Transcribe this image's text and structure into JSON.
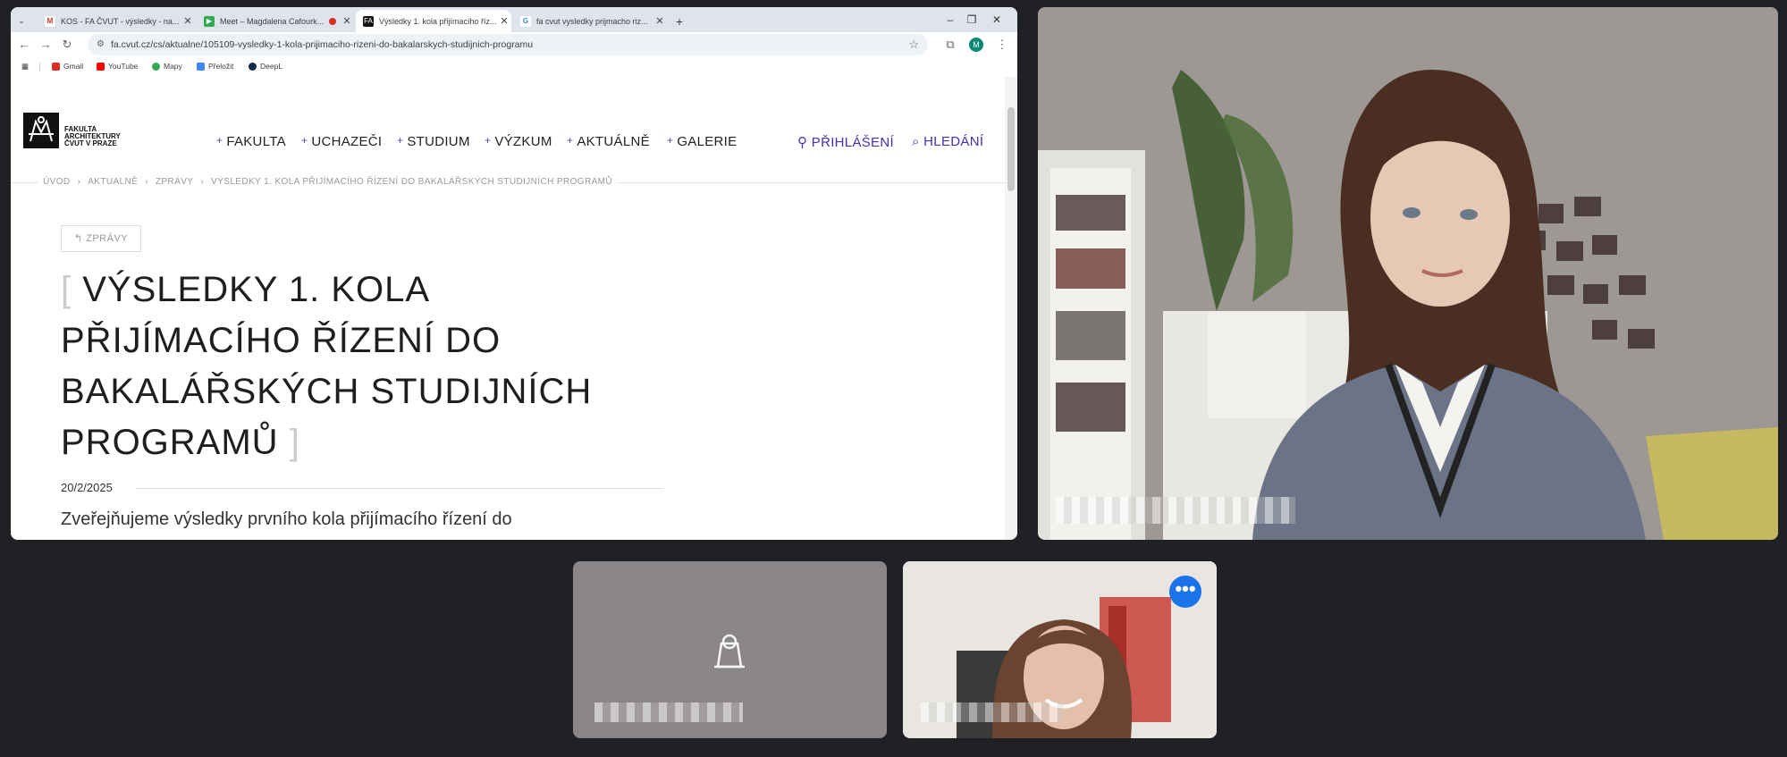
{
  "browser": {
    "tabs": [
      {
        "label": "KOS - FA ČVUT - výsledky - na...",
        "icon": "gmail-icon",
        "color": "#d93025"
      },
      {
        "label": "Meet – Magdalena Cafourk...",
        "icon": "meet-icon",
        "color": "#34a853"
      },
      {
        "label": "Výsledky 1. kola přijímacího říz...",
        "icon": "site-favicon",
        "color": "#111111"
      },
      {
        "label": "fa cvut vysledky prijmacho riz...",
        "icon": "google-icon",
        "color": "#4285f4"
      }
    ],
    "new_tab": "+",
    "tab_list": "⌄",
    "url": "fa.cvut.cz/cs/aktualne/105109-vysledky-1-kola-prijimaciho-rizeni-do-bakalarskych-studijnich-programu",
    "profile_initial": "M",
    "bookmarks": [
      {
        "label": "Gmail",
        "color": "#d93025"
      },
      {
        "label": "YouTube",
        "color": "#ff0000"
      },
      {
        "label": "Mapy",
        "color": "#34a853"
      },
      {
        "label": "Přeložit",
        "color": "#4285f4"
      },
      {
        "label": "DeepL",
        "color": "#0f2b46"
      }
    ]
  },
  "site": {
    "logo_lines": [
      "FAKULTA",
      "ARCHITEKTURY",
      "ČVUT V PRAZE"
    ],
    "menu": [
      "FAKULTA",
      "UCHAZEČI",
      "STUDIUM",
      "VÝZKUM",
      "AKTUÁLNĚ",
      "GALERIE"
    ],
    "login": "PŘIHLÁŠENÍ",
    "search": "HLEDÁNÍ",
    "breadcrumbs": [
      "ÚVOD",
      "AKTUALNĚ",
      "ZPRÁVY",
      "VÝSLEDKY 1. KOLA PŘIJÍMACÍHO ŘÍZENÍ DO BAKALÁŘSKÝCH STUDIJNÍCH PROGRAMŮ"
    ],
    "back_label": "ZPRÁVY",
    "headline_lines": [
      "VÝSLEDKY 1. KOLA",
      "PŘIJÍMACÍHO ŘÍZENÍ DO",
      "BAKALÁŘSKÝCH STUDIJNÍCH",
      "PROGRAMŮ"
    ],
    "date": "20/2/2025",
    "lead": "Zveřejňujeme výsledky prvního kola přijímacího řízení do"
  },
  "meet": {
    "more_options": "•••"
  }
}
